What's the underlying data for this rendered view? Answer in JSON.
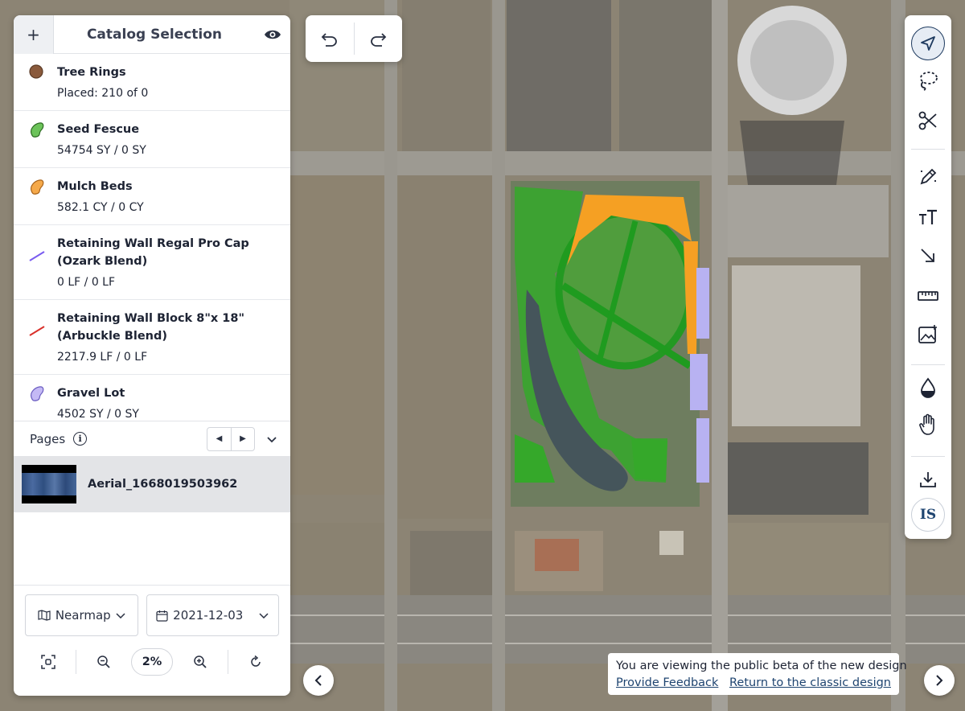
{
  "panel": {
    "title": "Catalog Selection",
    "add_label": "+",
    "items": [
      {
        "name": "Tree Rings",
        "qty": "Placed: 210 of 0",
        "symbol": "dot",
        "color": "#8a5a3c"
      },
      {
        "name": "Seed Fescue",
        "qty": "54754 SY / 0 SY",
        "symbol": "blob",
        "color": "#6cc35a"
      },
      {
        "name": "Mulch Beds",
        "qty": "582.1 CY / 0 CY",
        "symbol": "blob",
        "color": "#f5a94a"
      },
      {
        "name": "Retaining Wall Regal Pro Cap (Ozark Blend)",
        "qty": "0 LF / 0 LF",
        "symbol": "line",
        "color": "#7a5cf0"
      },
      {
        "name": "Retaining Wall Block 8\"x 18\" (Arbuckle Blend)",
        "qty": "2217.9 LF / 0 LF",
        "symbol": "line",
        "color": "#d9312b"
      },
      {
        "name": "Gravel Lot",
        "qty": "4502 SY / 0 SY",
        "symbol": "blob",
        "color": "#c4b9f5"
      }
    ],
    "pages_label": "Pages",
    "page": {
      "name": "Aerial_1668019503962"
    },
    "imagery_source": "Nearmap",
    "date": "2021-12-03",
    "zoom": "2%"
  },
  "beta": {
    "message": "You are viewing the public beta of the new design",
    "feedback_link": "Provide Feedback",
    "classic_link": "Return to the classic design"
  },
  "toolbar": {
    "badge": "IS",
    "tools": [
      "select-arrow-icon",
      "lasso-icon",
      "scissors-icon",
      "pencil-sparkle-icon",
      "text-size-icon",
      "arrow-icon",
      "ruler-icon",
      "add-image-icon",
      "water-drop-icon",
      "hand-icon",
      "download-icon"
    ]
  },
  "colors": {
    "accent": "#1e4470",
    "green_area": "#1f9b1f",
    "orange_area": "#f5a023",
    "lavender_area": "#b8b2f2"
  }
}
